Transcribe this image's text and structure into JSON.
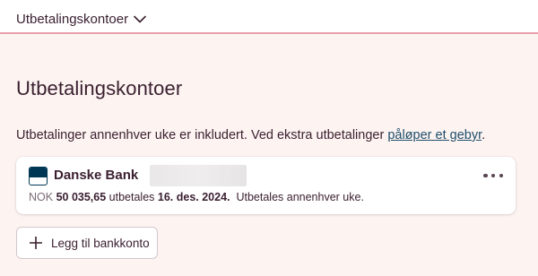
{
  "header": {
    "menu_label": "Utbetalingskontoer",
    "menu_icon": "chevron-down-icon"
  },
  "page": {
    "title": "Utbetalingskontoer",
    "info_text": "Utbetalinger annenhver uke er inkludert. Ved ekstra utbetalinger ",
    "info_link": "påløper et gebyr",
    "info_end": "."
  },
  "account": {
    "bank_name": "Danske Bank",
    "currency": "NOK",
    "amount": "50 035,65",
    "pays_text": "utbetales",
    "date": "16. des. 2024.",
    "frequency": "Utbetales annenhver uke.",
    "logo_color": "#003755",
    "more_icon": "more-horizontal-icon"
  },
  "actions": {
    "add_account_label": "Legg til bankkonto",
    "add_icon": "plus-icon"
  },
  "colors": {
    "background": "#fdf4f2",
    "accent_line": "#e8a0ac",
    "text": "#3a1f2f",
    "link": "#1f4e6b"
  }
}
